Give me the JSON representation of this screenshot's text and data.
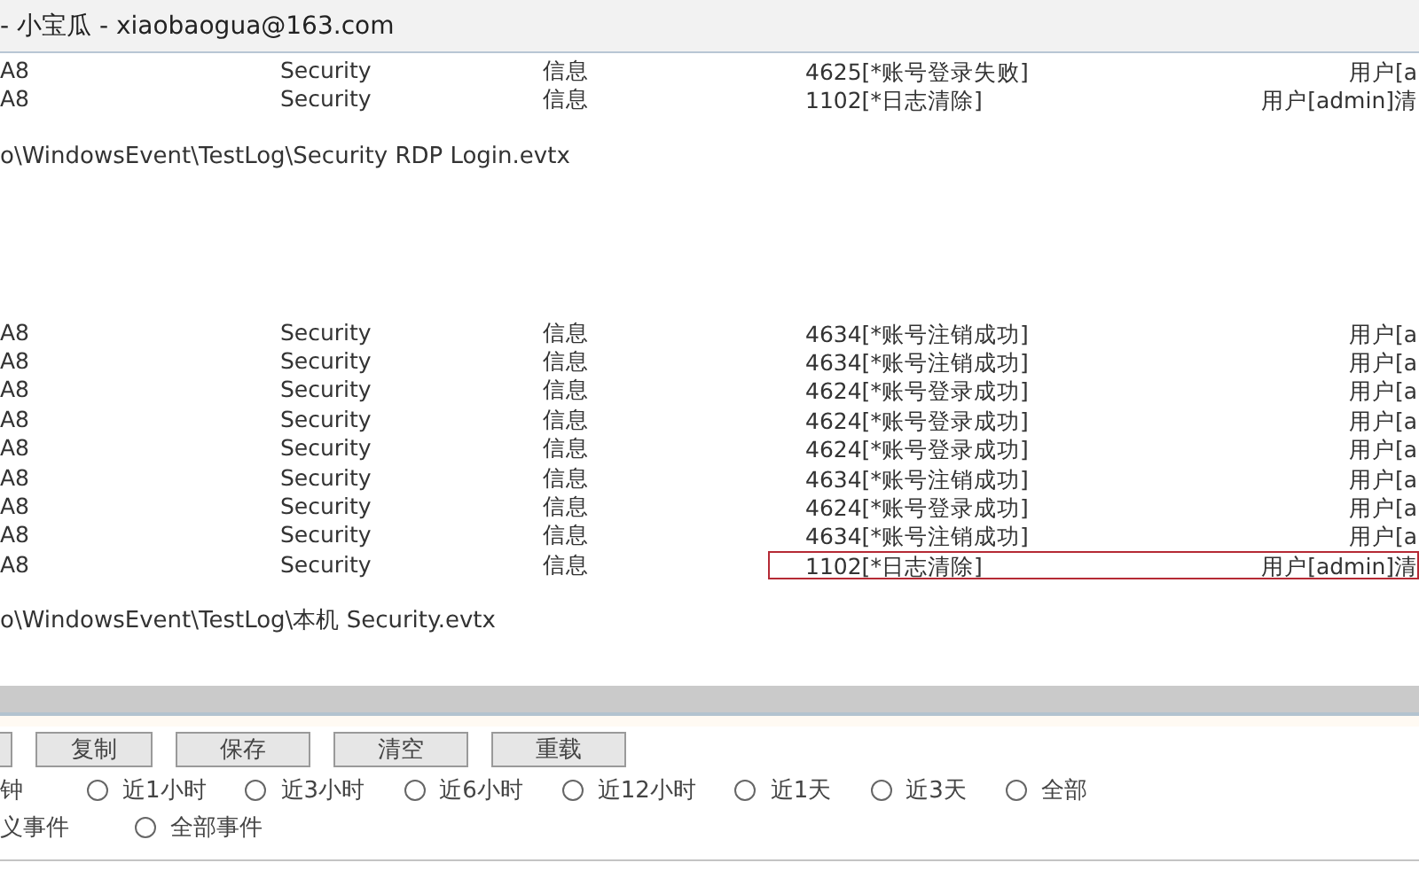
{
  "window": {
    "title": "- 小宝瓜 - xiaobaogua@163.com"
  },
  "log_groups": [
    {
      "rows": [
        {
          "column_1": "A8",
          "column_2": "Security",
          "column_3": "信息",
          "column_4": "4625[*账号登录失败]",
          "column_5": "用户[a",
          "highlighted": false
        },
        {
          "column_1": "A8",
          "column_2": "Security",
          "column_3": "信息",
          "column_4": "1102[*日志清除]",
          "column_5": "用户[admin]清",
          "highlighted": false
        }
      ],
      "path": "o\\WindowsEvent\\TestLog\\Security RDP Login.evtx"
    },
    {
      "rows": [
        {
          "column_1": "A8",
          "column_2": "Security",
          "column_3": "信息",
          "column_4": "4634[*账号注销成功]",
          "column_5": "用户[a",
          "highlighted": false
        },
        {
          "column_1": "A8",
          "column_2": "Security",
          "column_3": "信息",
          "column_4": "4634[*账号注销成功]",
          "column_5": "用户[a",
          "highlighted": false
        },
        {
          "column_1": "A8",
          "column_2": "Security",
          "column_3": "信息",
          "column_4": "4624[*账号登录成功]",
          "column_5": "用户[a",
          "highlighted": false
        },
        {
          "column_1": "A8",
          "column_2": "Security",
          "column_3": "信息",
          "column_4": "4624[*账号登录成功]",
          "column_5": "用户[a",
          "highlighted": false
        },
        {
          "column_1": "A8",
          "column_2": "Security",
          "column_3": "信息",
          "column_4": "4624[*账号登录成功]",
          "column_5": "用户[a",
          "highlighted": false
        },
        {
          "column_1": "A8",
          "column_2": "Security",
          "column_3": "信息",
          "column_4": "4634[*账号注销成功]",
          "column_5": "用户[a",
          "highlighted": false
        },
        {
          "column_1": "A8",
          "column_2": "Security",
          "column_3": "信息",
          "column_4": "4624[*账号登录成功]",
          "column_5": "用户[a",
          "highlighted": false
        },
        {
          "column_1": "A8",
          "column_2": "Security",
          "column_3": "信息",
          "column_4": "4634[*账号注销成功]",
          "column_5": "用户[a",
          "highlighted": false
        },
        {
          "column_1": "A8",
          "column_2": "Security",
          "column_3": "信息",
          "column_4": "1102[*日志清除]",
          "column_5": "用户[admin]清",
          "highlighted": true
        }
      ],
      "path": "o\\WindowsEvent\\TestLog\\本机 Security.evtx"
    }
  ],
  "buttons": [
    "复制",
    "保存",
    "清空",
    "重载"
  ],
  "time_options": [
    {
      "kind": "cut",
      "label": "钟"
    },
    {
      "kind": "radio",
      "label": "近1小时",
      "selected": false
    },
    {
      "kind": "radio",
      "label": "近3小时",
      "selected": false
    },
    {
      "kind": "radio",
      "label": "近6小时",
      "selected": false
    },
    {
      "kind": "radio",
      "label": "近12小时",
      "selected": false
    },
    {
      "kind": "radio",
      "label": "近1天",
      "selected": false
    },
    {
      "kind": "radio",
      "label": "近3天",
      "selected": false
    },
    {
      "kind": "radio",
      "label": "全部",
      "selected": false
    }
  ],
  "event_options": [
    {
      "kind": "cut",
      "label": "义事件"
    },
    {
      "kind": "radio",
      "label": "全部事件",
      "selected": false
    }
  ]
}
